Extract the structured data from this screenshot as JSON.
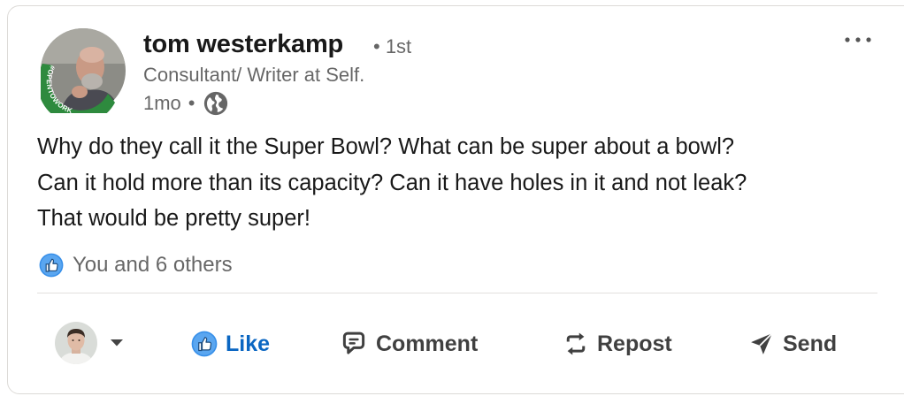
{
  "post": {
    "author": {
      "name": "tom westerkamp",
      "degree": "• 1st",
      "headline": "Consultant/ Writer at Self.",
      "timestamp": "1mo",
      "visibility_separator": "•",
      "visibility_icon": "globe-icon",
      "avatar_badge_text": "#OPENTOWORK"
    },
    "more_icon": "more-options-icon",
    "text_lines": [
      "Why do they call it the Super Bowl? What can be super about a bowl?",
      "Can it hold more than its capacity? Can it have holes in it and not leak?",
      "That would be pretty super!"
    ],
    "reactions": {
      "icon": "like-reaction-icon",
      "summary": "You and 6 others"
    }
  },
  "actions": {
    "like_label": "Like",
    "comment_label": "Comment",
    "repost_label": "Repost",
    "send_label": "Send"
  },
  "colors": {
    "accent": "#0a66c2",
    "opentowork_green": "#2e8a3e"
  }
}
